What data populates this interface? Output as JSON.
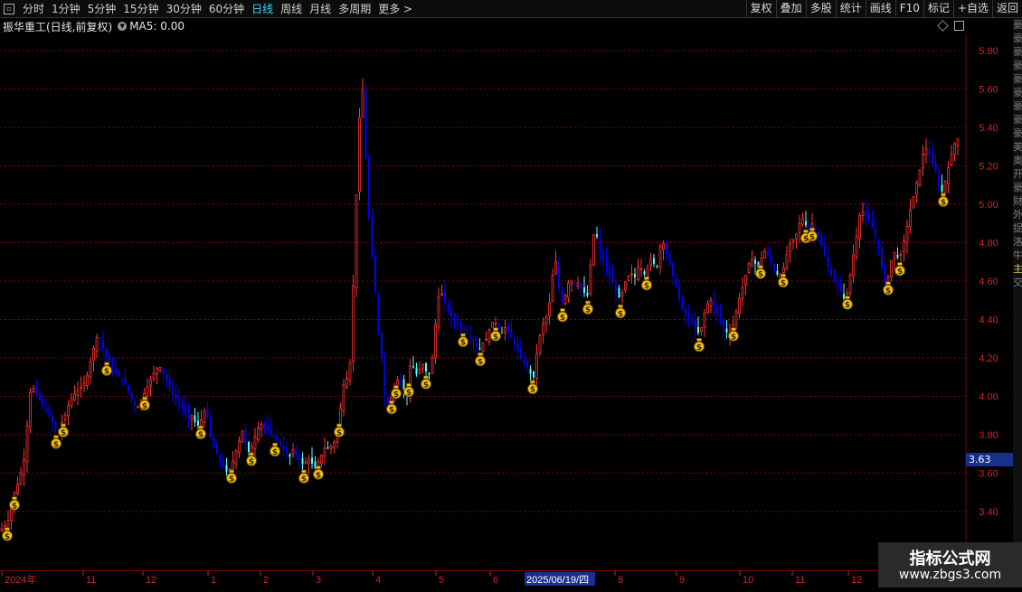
{
  "toolbar": {
    "tabs": [
      "分时",
      "1分钟",
      "5分钟",
      "15分钟",
      "30分钟",
      "60分钟",
      "日线",
      "周线",
      "月线",
      "多周期",
      "更多 >"
    ],
    "active_tab": "日线",
    "buttons": [
      "复权",
      "叠加",
      "多股",
      "统计",
      "画线",
      "F10",
      "标记",
      "+自选",
      "返回"
    ]
  },
  "info": {
    "title": "振华重工(日线,前复权)",
    "ma_label": "MA5: 0.00"
  },
  "price_box": "3.63",
  "right_strip": [
    "豪",
    "豪",
    "豪",
    "豪",
    "豪",
    "豪",
    "豪",
    "豪",
    "豪",
    "美",
    "奥",
    "开",
    "豪",
    "财",
    "外",
    "捉",
    "洛",
    "牛",
    "主",
    "交"
  ],
  "watermark": {
    "title": "指标公式网",
    "url": "www.zbgs3.com"
  },
  "colors": {
    "up": "#ff3232",
    "down": "#54ffff",
    "signal_down": "#0000ff",
    "grid": "#8b0000",
    "axis_text": "#c62828"
  },
  "chart_data": {
    "type": "candlestick",
    "y_ticks": [
      "5.80",
      "5.60",
      "5.40",
      "5.20",
      "5.00",
      "4.80",
      "4.60",
      "4.40",
      "4.20",
      "4.00",
      "3.80",
      "3.60",
      "3.40"
    ],
    "y_range": [
      3.28,
      5.9
    ],
    "x_labels": [
      "2024年",
      "11",
      "12",
      "1",
      "2",
      "3",
      "4",
      "5",
      "6",
      "2025/06/19/四",
      "8",
      "9",
      "10",
      "11",
      "12"
    ],
    "selected_date": "2025/06/19/四",
    "close_path": [
      [
        0,
        3.3
      ],
      [
        4,
        3.32
      ],
      [
        8,
        3.34
      ],
      [
        12,
        3.4
      ],
      [
        16,
        3.5
      ],
      [
        20,
        3.55
      ],
      [
        24,
        3.62
      ],
      [
        28,
        3.7
      ],
      [
        32,
        4.0
      ],
      [
        36,
        4.05
      ],
      [
        40,
        4.02
      ],
      [
        44,
        3.98
      ],
      [
        48,
        3.94
      ],
      [
        52,
        3.92
      ],
      [
        56,
        3.88
      ],
      [
        60,
        3.84
      ],
      [
        64,
        3.8
      ],
      [
        68,
        3.86
      ],
      [
        72,
        3.9
      ],
      [
        76,
        3.96
      ],
      [
        80,
        4.0
      ],
      [
        84,
        4.02
      ],
      [
        88,
        4.04
      ],
      [
        92,
        4.06
      ],
      [
        96,
        4.1
      ],
      [
        100,
        4.18
      ],
      [
        104,
        4.26
      ],
      [
        108,
        4.32
      ],
      [
        112,
        4.28
      ],
      [
        116,
        4.22
      ],
      [
        120,
        4.18
      ],
      [
        124,
        4.15
      ],
      [
        128,
        4.12
      ],
      [
        132,
        4.1
      ],
      [
        136,
        4.08
      ],
      [
        140,
        4.05
      ],
      [
        144,
        4.0
      ],
      [
        148,
        3.96
      ],
      [
        152,
        3.94
      ],
      [
        156,
        3.98
      ],
      [
        160,
        4.02
      ],
      [
        164,
        4.06
      ],
      [
        168,
        4.1
      ],
      [
        172,
        4.14
      ],
      [
        176,
        4.16
      ],
      [
        180,
        4.12
      ],
      [
        184,
        4.08
      ],
      [
        188,
        4.04
      ],
      [
        192,
        4.0
      ],
      [
        196,
        3.98
      ],
      [
        200,
        3.96
      ],
      [
        204,
        3.92
      ],
      [
        208,
        3.88
      ],
      [
        212,
        3.9
      ],
      [
        216,
        3.86
      ],
      [
        220,
        3.84
      ],
      [
        224,
        3.9
      ],
      [
        228,
        3.94
      ],
      [
        232,
        3.8
      ],
      [
        236,
        3.74
      ],
      [
        240,
        3.7
      ],
      [
        244,
        3.66
      ],
      [
        248,
        3.62
      ],
      [
        252,
        3.6
      ],
      [
        256,
        3.64
      ],
      [
        260,
        3.7
      ],
      [
        264,
        3.76
      ],
      [
        268,
        3.82
      ],
      [
        272,
        3.74
      ],
      [
        276,
        3.7
      ],
      [
        280,
        3.76
      ],
      [
        284,
        3.82
      ],
      [
        288,
        3.86
      ],
      [
        292,
        3.84
      ],
      [
        296,
        3.82
      ],
      [
        300,
        3.8
      ],
      [
        304,
        3.78
      ],
      [
        308,
        3.76
      ],
      [
        312,
        3.74
      ],
      [
        316,
        3.7
      ],
      [
        320,
        3.68
      ],
      [
        324,
        3.72
      ],
      [
        328,
        3.7
      ],
      [
        332,
        3.66
      ],
      [
        336,
        3.64
      ],
      [
        340,
        3.68
      ],
      [
        344,
        3.66
      ],
      [
        348,
        3.62
      ],
      [
        352,
        3.66
      ],
      [
        356,
        3.7
      ],
      [
        360,
        3.74
      ],
      [
        364,
        3.72
      ],
      [
        368,
        3.76
      ],
      [
        372,
        3.76
      ],
      [
        376,
        3.92
      ],
      [
        380,
        4.06
      ],
      [
        384,
        4.1
      ],
      [
        388,
        4.2
      ],
      [
        392,
        4.8
      ],
      [
        396,
        5.3
      ],
      [
        400,
        5.7
      ],
      [
        404,
        5.3
      ],
      [
        406,
        5.05
      ],
      [
        410,
        4.8
      ],
      [
        414,
        4.6
      ],
      [
        418,
        4.36
      ],
      [
        422,
        4.2
      ],
      [
        426,
        3.98
      ],
      [
        430,
        3.94
      ],
      [
        434,
        4.02
      ],
      [
        438,
        4.08
      ],
      [
        442,
        4.1
      ],
      [
        446,
        4.04
      ],
      [
        450,
        4.0
      ],
      [
        454,
        4.18
      ],
      [
        458,
        4.14
      ],
      [
        462,
        4.1
      ],
      [
        466,
        4.18
      ],
      [
        470,
        4.14
      ],
      [
        474,
        4.1
      ],
      [
        478,
        4.2
      ],
      [
        482,
        4.4
      ],
      [
        486,
        4.56
      ],
      [
        490,
        4.52
      ],
      [
        494,
        4.46
      ],
      [
        498,
        4.42
      ],
      [
        502,
        4.4
      ],
      [
        506,
        4.38
      ],
      [
        510,
        4.36
      ],
      [
        514,
        4.34
      ],
      [
        518,
        4.32
      ],
      [
        522,
        4.3
      ],
      [
        526,
        4.26
      ],
      [
        530,
        4.24
      ],
      [
        534,
        4.28
      ],
      [
        538,
        4.3
      ],
      [
        542,
        4.36
      ],
      [
        546,
        4.4
      ],
      [
        550,
        4.36
      ],
      [
        554,
        4.32
      ],
      [
        558,
        4.36
      ],
      [
        562,
        4.34
      ],
      [
        566,
        4.3
      ],
      [
        570,
        4.26
      ],
      [
        574,
        4.22
      ],
      [
        578,
        4.18
      ],
      [
        582,
        4.16
      ],
      [
        586,
        4.12
      ],
      [
        590,
        4.1
      ],
      [
        594,
        4.24
      ],
      [
        598,
        4.34
      ],
      [
        602,
        4.4
      ],
      [
        606,
        4.42
      ],
      [
        610,
        4.6
      ],
      [
        614,
        4.72
      ],
      [
        618,
        4.56
      ],
      [
        622,
        4.48
      ],
      [
        626,
        4.54
      ],
      [
        630,
        4.62
      ],
      [
        634,
        4.58
      ],
      [
        638,
        4.6
      ],
      [
        642,
        4.56
      ],
      [
        646,
        4.54
      ],
      [
        650,
        4.52
      ],
      [
        654,
        4.74
      ],
      [
        658,
        4.9
      ],
      [
        662,
        4.76
      ],
      [
        666,
        4.72
      ],
      [
        670,
        4.68
      ],
      [
        674,
        4.62
      ],
      [
        678,
        4.58
      ],
      [
        682,
        4.54
      ],
      [
        686,
        4.5
      ],
      [
        690,
        4.58
      ],
      [
        694,
        4.62
      ],
      [
        698,
        4.64
      ],
      [
        702,
        4.62
      ],
      [
        706,
        4.68
      ],
      [
        710,
        4.66
      ],
      [
        714,
        4.62
      ],
      [
        718,
        4.72
      ],
      [
        722,
        4.7
      ],
      [
        726,
        4.66
      ],
      [
        730,
        4.78
      ],
      [
        734,
        4.8
      ],
      [
        738,
        4.72
      ],
      [
        742,
        4.66
      ],
      [
        746,
        4.6
      ],
      [
        750,
        4.52
      ],
      [
        754,
        4.46
      ],
      [
        758,
        4.42
      ],
      [
        762,
        4.4
      ],
      [
        766,
        4.38
      ],
      [
        770,
        4.34
      ],
      [
        774,
        4.32
      ],
      [
        778,
        4.42
      ],
      [
        782,
        4.48
      ],
      [
        786,
        4.5
      ],
      [
        790,
        4.46
      ],
      [
        794,
        4.42
      ],
      [
        798,
        4.38
      ],
      [
        802,
        4.34
      ],
      [
        806,
        4.32
      ],
      [
        810,
        4.36
      ],
      [
        814,
        4.44
      ],
      [
        818,
        4.52
      ],
      [
        822,
        4.58
      ],
      [
        826,
        4.66
      ],
      [
        830,
        4.72
      ],
      [
        834,
        4.7
      ],
      [
        838,
        4.66
      ],
      [
        842,
        4.72
      ],
      [
        846,
        4.76
      ],
      [
        850,
        4.72
      ],
      [
        854,
        4.68
      ],
      [
        858,
        4.64
      ],
      [
        862,
        4.62
      ],
      [
        866,
        4.66
      ],
      [
        870,
        4.74
      ],
      [
        874,
        4.8
      ],
      [
        878,
        4.82
      ],
      [
        882,
        4.86
      ],
      [
        886,
        4.94
      ],
      [
        890,
        4.9
      ],
      [
        894,
        4.86
      ],
      [
        898,
        4.9
      ],
      [
        902,
        4.86
      ],
      [
        906,
        4.82
      ],
      [
        910,
        4.76
      ],
      [
        914,
        4.7
      ],
      [
        918,
        4.64
      ],
      [
        922,
        4.6
      ],
      [
        926,
        4.58
      ],
      [
        930,
        4.54
      ],
      [
        934,
        4.5
      ],
      [
        938,
        4.56
      ],
      [
        942,
        4.7
      ],
      [
        946,
        4.8
      ],
      [
        950,
        4.94
      ],
      [
        954,
        4.96
      ],
      [
        958,
        4.94
      ],
      [
        962,
        4.9
      ],
      [
        966,
        4.86
      ],
      [
        970,
        4.8
      ],
      [
        974,
        4.7
      ],
      [
        978,
        4.58
      ],
      [
        982,
        4.62
      ],
      [
        986,
        4.72
      ],
      [
        990,
        4.76
      ],
      [
        994,
        4.7
      ],
      [
        998,
        4.78
      ],
      [
        1002,
        4.86
      ],
      [
        1006,
        4.96
      ],
      [
        1010,
        5.04
      ],
      [
        1014,
        5.12
      ],
      [
        1018,
        5.2
      ],
      [
        1022,
        5.3
      ],
      [
        1026,
        5.28
      ],
      [
        1030,
        5.22
      ],
      [
        1034,
        5.18
      ],
      [
        1038,
        5.1
      ],
      [
        1042,
        5.06
      ],
      [
        1046,
        5.14
      ],
      [
        1050,
        5.22
      ],
      [
        1054,
        5.3
      ],
      [
        1058,
        5.34
      ]
    ],
    "signal_x": [
      8,
      16,
      62,
      70,
      118,
      160,
      222,
      256,
      278,
      304,
      336,
      352,
      375,
      433,
      438,
      452,
      471,
      512,
      531,
      548,
      589,
      622,
      650,
      686,
      715,
      773,
      811,
      841,
      866,
      891,
      898,
      937,
      982,
      995,
      1043
    ]
  }
}
